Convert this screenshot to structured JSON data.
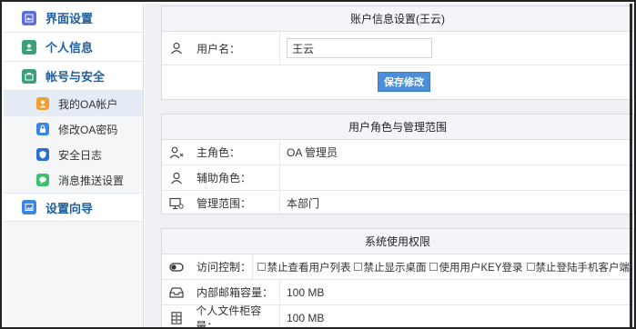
{
  "sidebar": {
    "sections": [
      {
        "label": "界面设置",
        "icon": "image-icon",
        "color": "#5b6ee1"
      },
      {
        "label": "个人信息",
        "icon": "user-card-icon",
        "color": "#3aa176"
      },
      {
        "label": "帐号与安全",
        "icon": "briefcase-icon",
        "color": "#3aa176"
      }
    ],
    "security_items": [
      {
        "label": "我的OA帐户",
        "icon": "user-icon",
        "color": "#f0a030"
      },
      {
        "label": "修改OA密码",
        "icon": "lock-icon",
        "color": "#3a86e0"
      },
      {
        "label": "安全日志",
        "icon": "shield-icon",
        "color": "#2d6fd0"
      },
      {
        "label": "消息推送设置",
        "icon": "chat-icon",
        "color": "#3cc16b"
      }
    ],
    "guide": {
      "label": "设置向导",
      "icon": "picture-icon",
      "color": "#3a86e0"
    }
  },
  "account_panel": {
    "title": "账户信息设置(王云)",
    "username_label": "用户名：",
    "username_value": "王云",
    "save_label": "保存修改"
  },
  "role_panel": {
    "title": "用户角色与管理范围",
    "rows": [
      {
        "label": "主角色：",
        "value": "OA 管理员"
      },
      {
        "label": "辅助角色：",
        "value": ""
      },
      {
        "label": "管理范围：",
        "value": "本部门"
      }
    ]
  },
  "perm_panel": {
    "title": "系统使用权限",
    "access_label": "访问控制：",
    "access_options": [
      "禁止查看用户列表",
      "禁止显示桌面",
      "使用用户KEY登录",
      "禁止登陆手机客户端"
    ],
    "mail_label": "内部邮箱容量：",
    "mail_value": "100 MB",
    "cabinet_label": "个人文件柜容量：",
    "cabinet_value": "100 MB"
  }
}
